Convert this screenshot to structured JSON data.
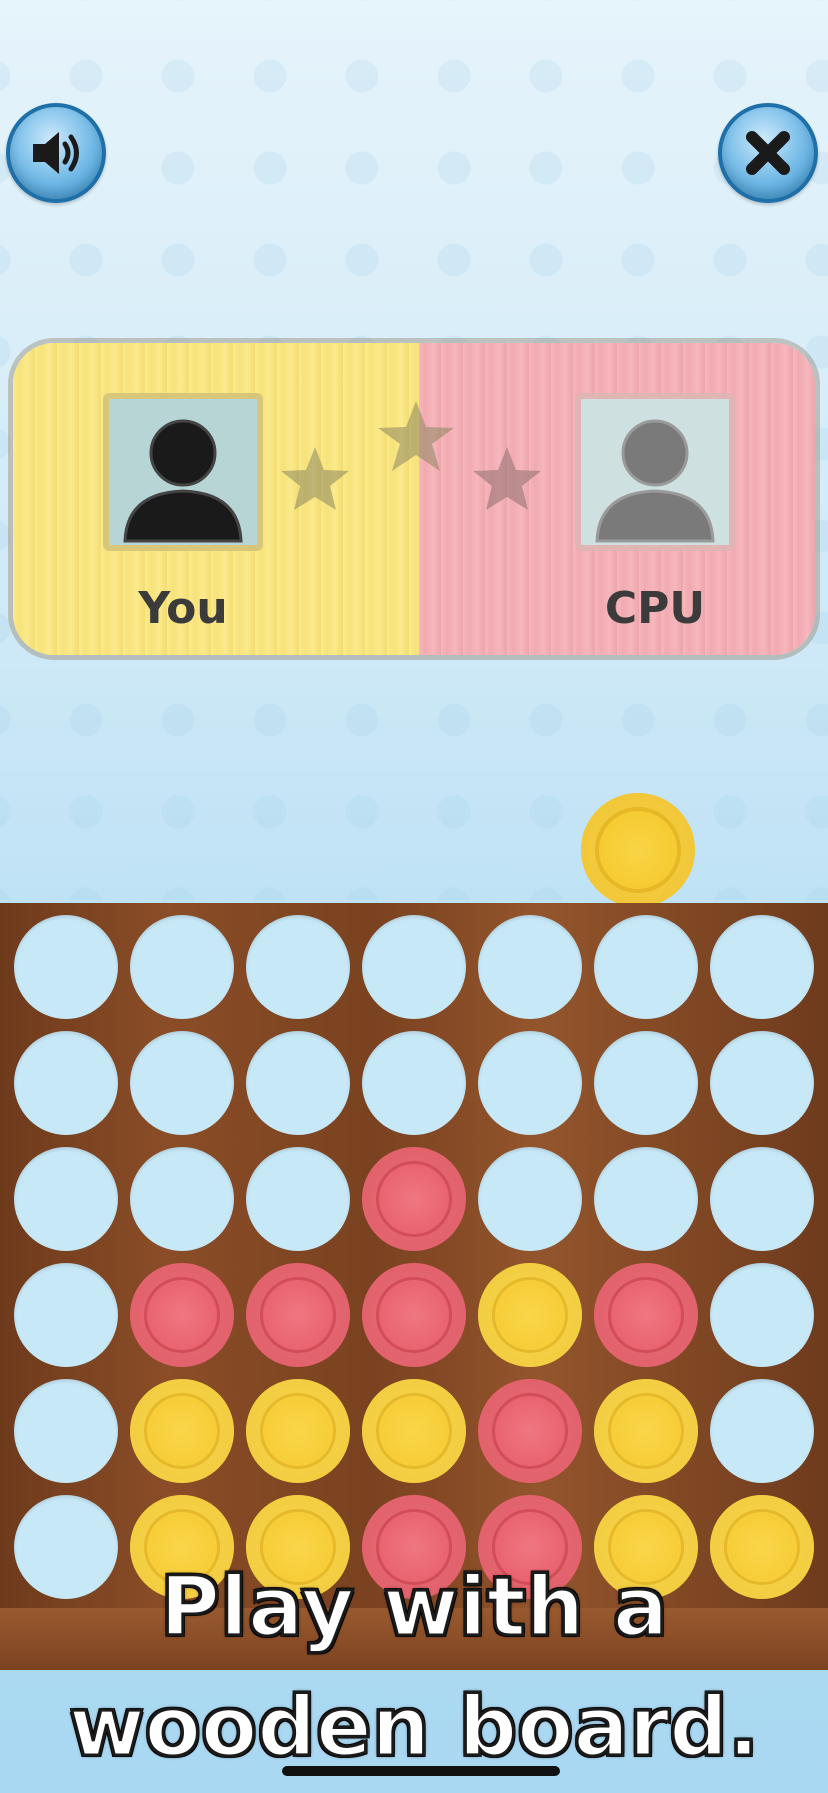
{
  "players": {
    "you_label": "You",
    "cpu_label": "CPU"
  },
  "stars": {
    "filled": 0,
    "total": 3
  },
  "colors": {
    "you": "#fbeb8c",
    "cpu": "#f6b7bc",
    "red_disc": "#e9606d",
    "yellow_disc": "#f6cc35",
    "empty_slot": "#c7e8f7",
    "board_wood": "#7a4220"
  },
  "board": {
    "columns": 7,
    "rows": 6,
    "cells": [
      [
        "empty",
        "empty",
        "empty",
        "empty",
        "empty",
        "empty",
        "empty"
      ],
      [
        "empty",
        "empty",
        "empty",
        "empty",
        "empty",
        "empty",
        "empty"
      ],
      [
        "empty",
        "empty",
        "empty",
        "red",
        "empty",
        "empty",
        "empty"
      ],
      [
        "empty",
        "red",
        "red",
        "red",
        "yellow",
        "red",
        "empty"
      ],
      [
        "empty",
        "yellow",
        "yellow",
        "yellow",
        "red",
        "yellow",
        "empty"
      ],
      [
        "empty",
        "yellow",
        "yellow",
        "red",
        "red",
        "yellow",
        "yellow"
      ]
    ],
    "drop_column": 5,
    "drop_disc": "yellow"
  },
  "caption": {
    "line1": "Play with a",
    "line2": "wooden board."
  },
  "icons": {
    "sound": "speaker-icon",
    "close": "close-icon"
  }
}
